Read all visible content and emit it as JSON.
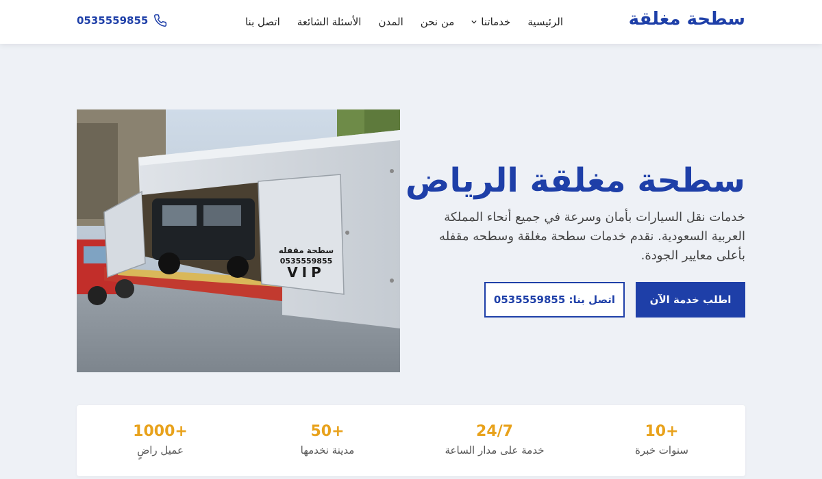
{
  "header": {
    "logo": "سطحة مغلقة",
    "nav": [
      {
        "label": "الرئيسية"
      },
      {
        "label": "خدماتنا",
        "has_dropdown": true
      },
      {
        "label": "من نحن"
      },
      {
        "label": "المدن"
      },
      {
        "label": "الأسئلة الشائعة"
      },
      {
        "label": "اتصل بنا"
      }
    ],
    "phone": "0535559855",
    "phone_icon": "phone-icon"
  },
  "hero": {
    "title": "سطحة مغلقة الرياض",
    "description": "خدمات نقل السيارات بأمان وسرعة في جميع أنحاء المملكة العربية السعودية. نقدم خدمات سطحة مغلقة وسطحه مقفله بأعلى معايير الجودة.",
    "primary_button": "اطلب خدمة الآن",
    "secondary_button": "اتصل بنا: 0535559855",
    "image_text": {
      "brand": "سطحة مقفله",
      "phone": "0535559855",
      "badge": "VIP"
    }
  },
  "stats": [
    {
      "value": "10+",
      "label": "سنوات خبرة"
    },
    {
      "value": "24/7",
      "label": "خدمة على مدار الساعة"
    },
    {
      "value": "50+",
      "label": "مدينة نخدمها"
    },
    {
      "value": "1000+",
      "label": "عميل راضٍ"
    }
  ],
  "colors": {
    "brand_blue": "#1e3fa8",
    "accent_orange": "#e8a21c",
    "page_background": "#eef1f6"
  }
}
